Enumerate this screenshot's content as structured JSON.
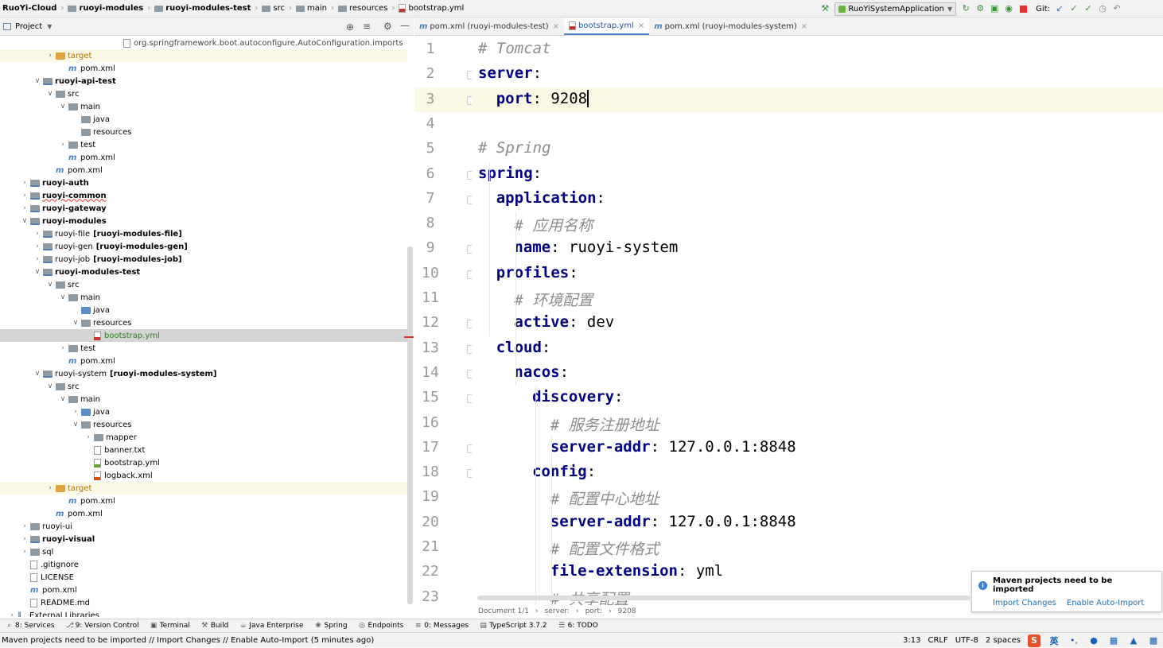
{
  "navbar": {
    "crumbs": [
      "RuoYi-Cloud",
      "ruoyi-modules",
      "ruoyi-modules-test",
      "src",
      "main",
      "resources",
      "bootstrap.yml"
    ],
    "run_config": "RuoYiSystemApplication",
    "git_label": "Git:"
  },
  "project_panel": {
    "title": "Project"
  },
  "tree": [
    {
      "indent": 9,
      "arrow": "",
      "icon": "file",
      "label": "org.springframework.boot.autoconfigure.AutoConfiguration.imports",
      "style": "gray"
    },
    {
      "indent": 3,
      "arrow": ">",
      "icon": "folder-orange",
      "label": "target",
      "style": "orange",
      "hl": true
    },
    {
      "indent": 4,
      "arrow": "",
      "icon": "m",
      "label": "pom.xml",
      "style": ""
    },
    {
      "indent": 2,
      "arrow": "v",
      "icon": "folder-mod",
      "label": "ruoyi-api-test",
      "style": "bold"
    },
    {
      "indent": 3,
      "arrow": "v",
      "icon": "folder",
      "label": "src",
      "style": ""
    },
    {
      "indent": 4,
      "arrow": "v",
      "icon": "folder",
      "label": "main",
      "style": ""
    },
    {
      "indent": 5,
      "arrow": "",
      "icon": "folder",
      "label": "java",
      "style": ""
    },
    {
      "indent": 5,
      "arrow": "",
      "icon": "folder",
      "label": "resources",
      "style": ""
    },
    {
      "indent": 4,
      "arrow": ">",
      "icon": "folder",
      "label": "test",
      "style": ""
    },
    {
      "indent": 4,
      "arrow": "",
      "icon": "m",
      "label": "pom.xml",
      "style": ""
    },
    {
      "indent": 3,
      "arrow": "",
      "icon": "m",
      "label": "pom.xml",
      "style": ""
    },
    {
      "indent": 1,
      "arrow": ">",
      "icon": "folder-mod",
      "label": "ruoyi-auth",
      "style": "bold"
    },
    {
      "indent": 1,
      "arrow": ">",
      "icon": "folder-mod",
      "label": "ruoyi-common",
      "style": "bold"
    },
    {
      "indent": 1,
      "arrow": ">",
      "icon": "folder-mod",
      "label": "ruoyi-gateway",
      "style": "bold"
    },
    {
      "indent": 1,
      "arrow": "v",
      "icon": "folder-mod",
      "label": "ruoyi-modules",
      "style": "bold"
    },
    {
      "indent": 2,
      "arrow": ">",
      "icon": "folder-mod",
      "label": "ruoyi-file",
      "extra": "[ruoyi-modules-file]",
      "style": ""
    },
    {
      "indent": 2,
      "arrow": ">",
      "icon": "folder-mod",
      "label": "ruoyi-gen",
      "extra": "[ruoyi-modules-gen]",
      "style": ""
    },
    {
      "indent": 2,
      "arrow": ">",
      "icon": "folder-mod",
      "label": "ruoyi-job",
      "extra": "[ruoyi-modules-job]",
      "style": ""
    },
    {
      "indent": 2,
      "arrow": "v",
      "icon": "folder-mod",
      "label": "ruoyi-modules-test",
      "style": "bold"
    },
    {
      "indent": 3,
      "arrow": "v",
      "icon": "folder",
      "label": "src",
      "style": ""
    },
    {
      "indent": 4,
      "arrow": "v",
      "icon": "folder",
      "label": "main",
      "style": ""
    },
    {
      "indent": 5,
      "arrow": "",
      "icon": "folder-blue",
      "label": "java",
      "style": ""
    },
    {
      "indent": 5,
      "arrow": "v",
      "icon": "folder",
      "label": "resources",
      "style": ""
    },
    {
      "indent": 6,
      "arrow": "",
      "icon": "yml",
      "label": "bootstrap.yml",
      "style": "green",
      "sel": true
    },
    {
      "indent": 4,
      "arrow": ">",
      "icon": "folder",
      "label": "test",
      "style": ""
    },
    {
      "indent": 4,
      "arrow": "",
      "icon": "m",
      "label": "pom.xml",
      "style": ""
    },
    {
      "indent": 2,
      "arrow": "v",
      "icon": "folder-mod",
      "label": "ruoyi-system",
      "extra": "[ruoyi-modules-system]",
      "style": ""
    },
    {
      "indent": 3,
      "arrow": "v",
      "icon": "folder",
      "label": "src",
      "style": ""
    },
    {
      "indent": 4,
      "arrow": "v",
      "icon": "folder",
      "label": "main",
      "style": ""
    },
    {
      "indent": 5,
      "arrow": ">",
      "icon": "folder-blue",
      "label": "java",
      "style": ""
    },
    {
      "indent": 5,
      "arrow": "v",
      "icon": "folder",
      "label": "resources",
      "style": ""
    },
    {
      "indent": 6,
      "arrow": ">",
      "icon": "folder",
      "label": "mapper",
      "style": ""
    },
    {
      "indent": 6,
      "arrow": "",
      "icon": "file",
      "label": "banner.txt",
      "style": ""
    },
    {
      "indent": 6,
      "arrow": "",
      "icon": "yml2",
      "label": "bootstrap.yml",
      "style": ""
    },
    {
      "indent": 6,
      "arrow": "",
      "icon": "xml",
      "label": "logback.xml",
      "style": ""
    },
    {
      "indent": 3,
      "arrow": ">",
      "icon": "folder-orange",
      "label": "target",
      "style": "orange",
      "hl": true
    },
    {
      "indent": 4,
      "arrow": "",
      "icon": "m",
      "label": "pom.xml",
      "style": ""
    },
    {
      "indent": 3,
      "arrow": "",
      "icon": "m",
      "label": "pom.xml",
      "style": ""
    },
    {
      "indent": 1,
      "arrow": ">",
      "icon": "folder",
      "label": "ruoyi-ui",
      "style": ""
    },
    {
      "indent": 1,
      "arrow": ">",
      "icon": "folder-mod",
      "label": "ruoyi-visual",
      "style": "bold"
    },
    {
      "indent": 1,
      "arrow": ">",
      "icon": "folder",
      "label": "sql",
      "style": ""
    },
    {
      "indent": 1,
      "arrow": "",
      "icon": "file",
      "label": ".gitignore",
      "style": ""
    },
    {
      "indent": 1,
      "arrow": "",
      "icon": "file",
      "label": "LICENSE",
      "style": ""
    },
    {
      "indent": 1,
      "arrow": "",
      "icon": "m",
      "label": "pom.xml",
      "style": ""
    },
    {
      "indent": 1,
      "arrow": "",
      "icon": "file",
      "label": "README.md",
      "style": ""
    },
    {
      "indent": 0,
      "arrow": ">",
      "icon": "lib",
      "label": "External Libraries",
      "style": ""
    }
  ],
  "editor_tabs": [
    {
      "label": "pom.xml (ruoyi-modules-test)",
      "icon": "m",
      "active": false
    },
    {
      "label": "bootstrap.yml",
      "icon": "yml",
      "active": true
    },
    {
      "label": "pom.xml (ruoyi-modules-system)",
      "icon": "m",
      "active": false
    }
  ],
  "code_lines": [
    {
      "n": "1",
      "indent": 0,
      "parts": [
        {
          "t": "# Tomcat",
          "c": "c"
        }
      ]
    },
    {
      "n": "2",
      "indent": 0,
      "parts": [
        {
          "t": "server",
          "c": "k"
        },
        {
          "t": ":",
          "c": "v"
        }
      ]
    },
    {
      "n": "3",
      "indent": 1,
      "parts": [
        {
          "t": "port",
          "c": "k"
        },
        {
          "t": ": 9208",
          "c": "v"
        }
      ]
    },
    {
      "n": "4",
      "indent": 0,
      "parts": []
    },
    {
      "n": "5",
      "indent": 0,
      "parts": [
        {
          "t": "# Spring",
          "c": "c"
        }
      ]
    },
    {
      "n": "6",
      "indent": 0,
      "parts": [
        {
          "t": "spring",
          "c": "k"
        },
        {
          "t": ":",
          "c": "v"
        }
      ]
    },
    {
      "n": "7",
      "indent": 1,
      "parts": [
        {
          "t": "application",
          "c": "k"
        },
        {
          "t": ":",
          "c": "v"
        }
      ]
    },
    {
      "n": "8",
      "indent": 2,
      "parts": [
        {
          "t": "# 应用名称",
          "c": "c"
        }
      ]
    },
    {
      "n": "9",
      "indent": 2,
      "parts": [
        {
          "t": "name",
          "c": "k"
        },
        {
          "t": ": ruoyi-system",
          "c": "v"
        }
      ]
    },
    {
      "n": "10",
      "indent": 1,
      "parts": [
        {
          "t": "profiles",
          "c": "k"
        },
        {
          "t": ":",
          "c": "v"
        }
      ]
    },
    {
      "n": "11",
      "indent": 2,
      "parts": [
        {
          "t": "# 环境配置",
          "c": "c"
        }
      ]
    },
    {
      "n": "12",
      "indent": 2,
      "parts": [
        {
          "t": "active",
          "c": "k"
        },
        {
          "t": ": dev",
          "c": "v"
        }
      ]
    },
    {
      "n": "13",
      "indent": 1,
      "parts": [
        {
          "t": "cloud",
          "c": "k"
        },
        {
          "t": ":",
          "c": "v"
        }
      ]
    },
    {
      "n": "14",
      "indent": 2,
      "parts": [
        {
          "t": "nacos",
          "c": "k"
        },
        {
          "t": ":",
          "c": "v"
        }
      ]
    },
    {
      "n": "15",
      "indent": 3,
      "parts": [
        {
          "t": "discovery",
          "c": "k"
        },
        {
          "t": ":",
          "c": "v"
        }
      ]
    },
    {
      "n": "16",
      "indent": 4,
      "parts": [
        {
          "t": "# 服务注册地址",
          "c": "c"
        }
      ]
    },
    {
      "n": "17",
      "indent": 4,
      "parts": [
        {
          "t": "server-addr",
          "c": "k"
        },
        {
          "t": ": 127.0.0.1:8848",
          "c": "v"
        }
      ]
    },
    {
      "n": "18",
      "indent": 3,
      "parts": [
        {
          "t": "config",
          "c": "k"
        },
        {
          "t": ":",
          "c": "v"
        }
      ]
    },
    {
      "n": "19",
      "indent": 4,
      "parts": [
        {
          "t": "# 配置中心地址",
          "c": "c"
        }
      ]
    },
    {
      "n": "20",
      "indent": 4,
      "parts": [
        {
          "t": "server-addr",
          "c": "k"
        },
        {
          "t": ": 127.0.0.1:8848",
          "c": "v"
        }
      ]
    },
    {
      "n": "21",
      "indent": 4,
      "parts": [
        {
          "t": "# 配置文件格式",
          "c": "c"
        }
      ]
    },
    {
      "n": "22",
      "indent": 4,
      "parts": [
        {
          "t": "file-extension",
          "c": "k"
        },
        {
          "t": ": yml",
          "c": "v"
        }
      ]
    },
    {
      "n": "23",
      "indent": 4,
      "parts": [
        {
          "t": "# 共享配置",
          "c": "c"
        }
      ]
    }
  ],
  "editor_breadcrumb": [
    "Document 1/1",
    "server:",
    "port:",
    "9208"
  ],
  "popup": {
    "title": "Maven projects need to be imported",
    "import_changes": "Import Changes",
    "enable_auto_import": "Enable Auto-Import"
  },
  "tool_windows": [
    {
      "label": "8: Services",
      "icon": "search-icon"
    },
    {
      "label": "9: Version Control",
      "icon": "vcs-icon"
    },
    {
      "label": "Terminal",
      "icon": "terminal-icon"
    },
    {
      "label": "Build",
      "icon": "hammer-icon"
    },
    {
      "label": "Java Enterprise",
      "icon": "java-ee-icon"
    },
    {
      "label": "Spring",
      "icon": "spring-icon"
    },
    {
      "label": "Endpoints",
      "icon": "endpoints-icon"
    },
    {
      "label": "0: Messages",
      "icon": "messages-icon"
    },
    {
      "label": "TypeScript 3.7.2",
      "icon": "typescript-icon"
    },
    {
      "label": "6: TODO",
      "icon": "todo-icon"
    }
  ],
  "status": {
    "message": "Maven projects need to be imported // Import Changes // Enable Auto-Import (5 minutes ago)",
    "position": "3:13",
    "line_sep": "CRLF",
    "encoding": "UTF-8",
    "indent": "2 spaces",
    "ime_label": "英"
  }
}
